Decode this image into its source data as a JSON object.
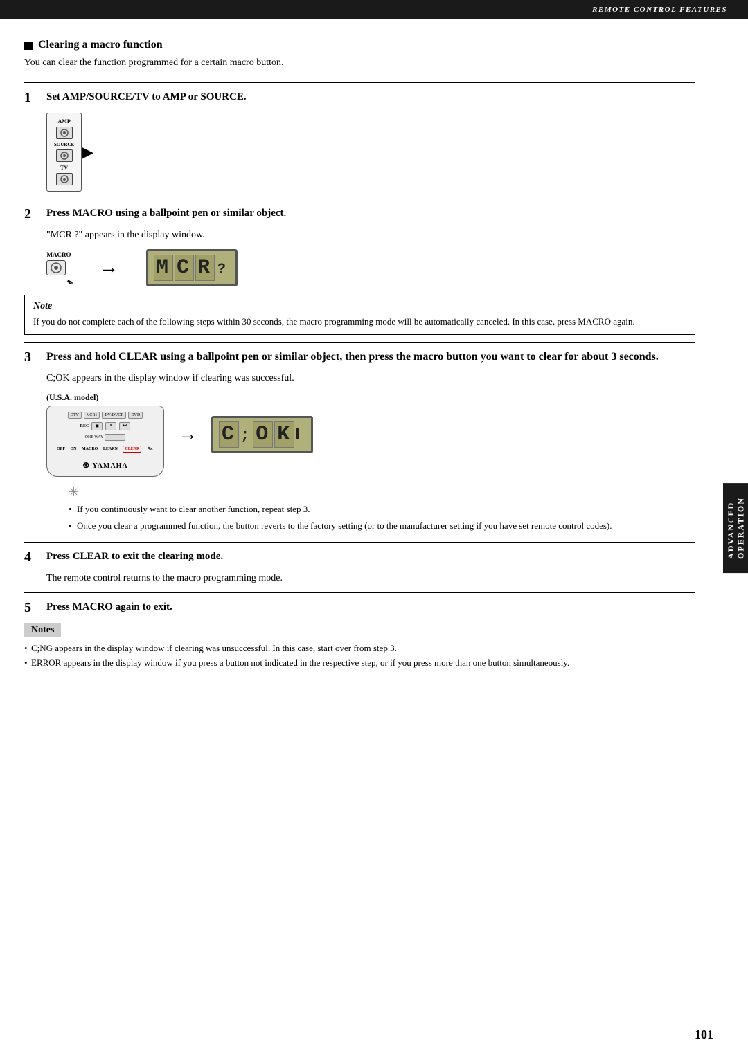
{
  "header": {
    "title": "REMOTE CONTROL FEATURES"
  },
  "page_number": "101",
  "right_tab": {
    "line1": "ADVANCED",
    "line2": "OPERATION"
  },
  "section": {
    "title": "Clearing a macro function",
    "intro": "You can clear the function programmed for a certain macro button."
  },
  "steps": [
    {
      "number": "1",
      "title": "Set AMP/SOURCE/TV to AMP or SOURCE.",
      "description": "",
      "has_diagram": true
    },
    {
      "number": "2",
      "title": "Press MACRO using a ballpoint pen or similar object.",
      "description": "\"MCR ?\" appears in the display window.",
      "display_text": "MCR ?",
      "has_diagram": true
    },
    {
      "number": "3",
      "title": "Press and hold CLEAR using a ballpoint pen or similar object, then press the macro button you want to clear for about 3 seconds.",
      "description": "C;OK appears in the display window if clearing was successful.",
      "display_text": "C;OK",
      "model_label": "(U.S.A. model)",
      "has_diagram": true
    },
    {
      "number": "4",
      "title": "Press CLEAR to exit the clearing mode.",
      "description": "The remote control returns to the macro programming mode."
    },
    {
      "number": "5",
      "title": "Press MACRO again to exit.",
      "description": ""
    }
  ],
  "note": {
    "title": "Note",
    "text": "If you do not complete each of the following steps within 30 seconds, the macro programming mode will be automatically canceled. In this case, press MACRO again."
  },
  "tip_items": [
    "If you continuously want to clear another function, repeat step 3.",
    "Once you clear a programmed function, the button reverts to the factory setting (or to the manufacturer setting if you have set remote control codes)."
  ],
  "notes_final": {
    "title": "Notes",
    "items": [
      "C;NG appears in the display window if clearing was unsuccessful. In this case, start over from step 3.",
      "ERROR appears in the display window if you press a button not indicated in the respective step, or if you press more than one button simultaneously."
    ]
  }
}
